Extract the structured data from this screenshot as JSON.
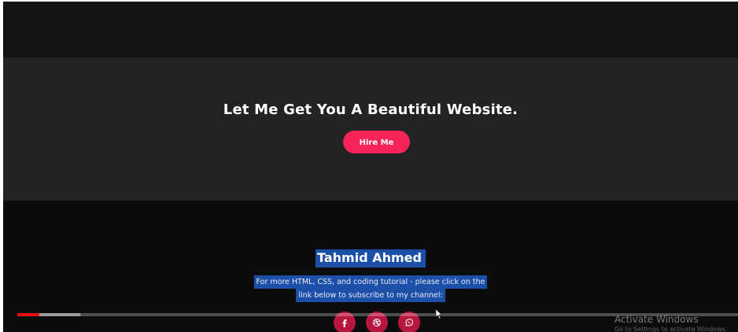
{
  "hero": {
    "title": "Let Me Get You A Beautiful Website.",
    "button_label": "Hire Me"
  },
  "footer": {
    "author": "Tahmid Ahmed",
    "description_line1": "For more HTML, CSS, and coding tutorial - please click on the",
    "description_line2": "link below to subscribe to my channel:",
    "socials": [
      {
        "icon": "facebook-icon"
      },
      {
        "icon": "dribbble-icon"
      },
      {
        "icon": "whatsapp-icon"
      }
    ]
  },
  "player": {
    "played_fraction": 0.031,
    "buffered_fraction": 0.087
  },
  "watermark": {
    "title": "Activate Windows",
    "subtitle": "Go to Settings to activate Windows."
  },
  "colors": {
    "accent": "#f4245a",
    "social_bg": "#b7163f",
    "selection": "#1b4fa8",
    "progress": "#e50914"
  }
}
